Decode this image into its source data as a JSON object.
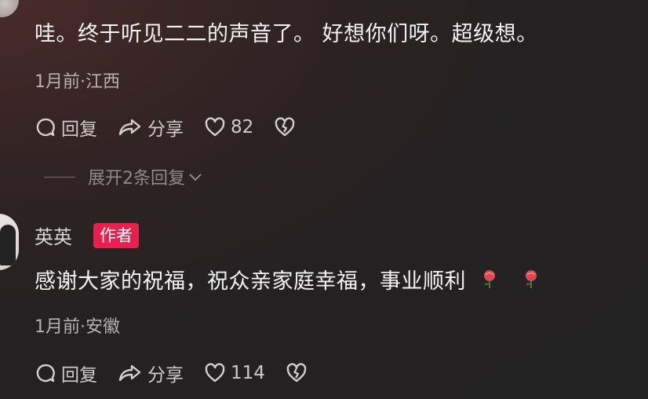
{
  "comment1": {
    "text": "哇。终于听见二二的声音了。 好想你们呀。超级想。",
    "time": "1月前",
    "location": "江西",
    "reply_label": "回复",
    "share_label": "分享",
    "like_count": "82"
  },
  "expand_replies": {
    "label": "展开2条回复"
  },
  "comment2": {
    "user": "英英",
    "badge": "作者",
    "text": "感谢大家的祝福，祝众亲家庭幸福，事业顺利",
    "time": "1月前",
    "location": "安徽",
    "reply_label": "回复",
    "share_label": "分享",
    "like_count": "114"
  },
  "colors": {
    "badge": "#e8204f",
    "background": "#232223"
  },
  "icons": [
    "reply-icon",
    "share-icon",
    "like-icon",
    "dislike-icon",
    "chevron-down-icon",
    "rose-emoji-icon"
  ]
}
